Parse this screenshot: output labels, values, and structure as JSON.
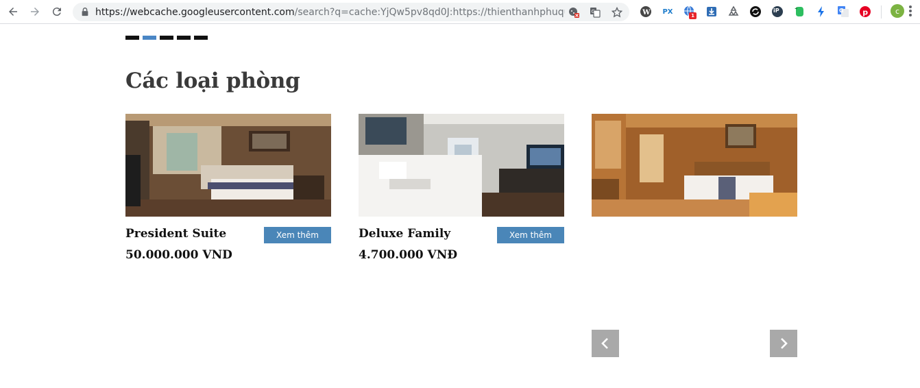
{
  "browser": {
    "url_host": "https://webcache.googleusercontent.com",
    "url_rest": "/search?q=cache:YjQw5pv8qd0J:https://thienthanhphuqu...",
    "extensions": [
      {
        "icon": "wordpress-icon"
      },
      {
        "icon": "px-extension-icon",
        "label": "PX"
      },
      {
        "icon": "globe-badge-icon",
        "badge": "1"
      },
      {
        "icon": "download-icon"
      },
      {
        "icon": "recycle-icon"
      },
      {
        "icon": "sync-icon"
      },
      {
        "icon": "ip-icon",
        "label": "iP"
      },
      {
        "icon": "evernote-icon"
      },
      {
        "icon": "bolt-icon"
      },
      {
        "icon": "google-translate-icon"
      },
      {
        "icon": "pinterest-icon"
      }
    ],
    "profile_initial": "c",
    "colors": {
      "toolbar_bg": "#ffffff",
      "omnibox_bg": "#f1f3f4",
      "avatar": "#7cb342"
    }
  },
  "page": {
    "section_title": "Các loại phòng",
    "indicators": [
      {
        "active": false
      },
      {
        "active": true
      },
      {
        "active": false
      },
      {
        "active": false
      },
      {
        "active": false
      }
    ],
    "rooms": [
      {
        "name": "President Suite",
        "price": "50.000.000 VND",
        "button_label": "Xem thêm",
        "image": "president-suite-photo"
      },
      {
        "name": "Deluxe Family",
        "price": "4.700.000 VNĐ",
        "button_label": "Xem thêm",
        "image": "deluxe-family-photo"
      },
      {
        "image": "wooden-room-photo"
      }
    ],
    "colors": {
      "accent": "#4a86b8",
      "indicator_active": "#4a86c5",
      "arrow_bg": "#a9a9a9"
    }
  }
}
